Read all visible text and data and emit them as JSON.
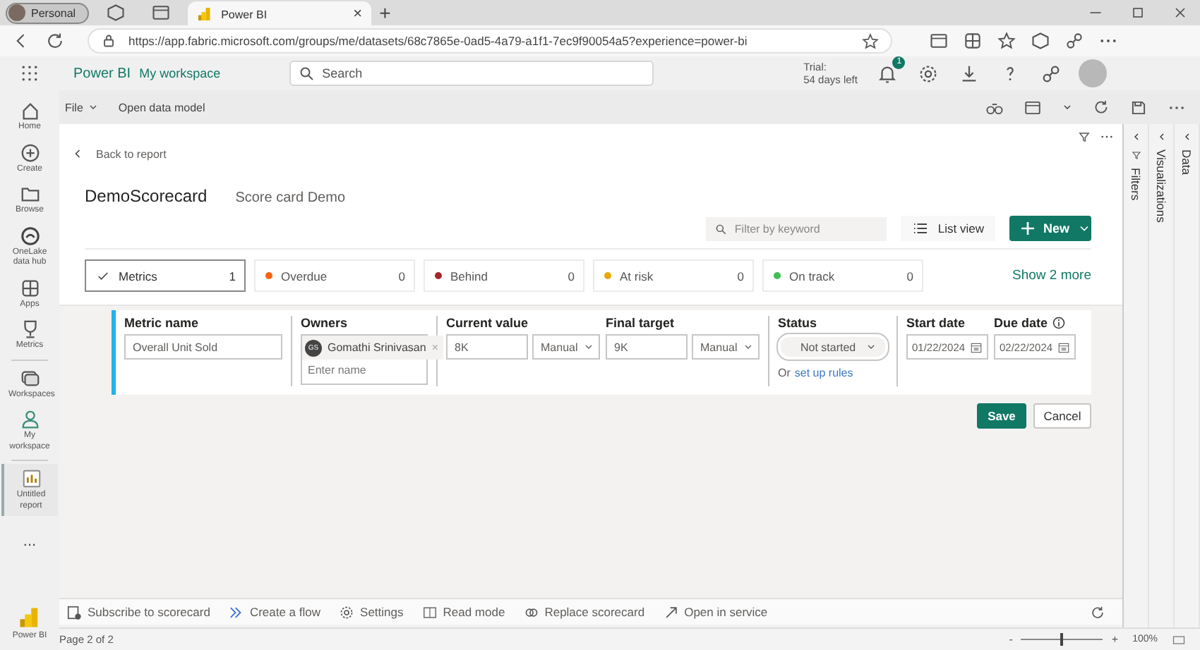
{
  "browser": {
    "profile": "Personal",
    "tabs": [
      {
        "title": "Power BI",
        "selected": true,
        "close": "×"
      }
    ],
    "new_tab": "+",
    "url": "https://app.fabric.microsoft.com/groups/me/datasets/68c7865e-0ad5-4a79-a1f1-7ec9f90054a5?experience=power-bi"
  },
  "header": {
    "app": "Power BI",
    "workspace": "My workspace",
    "search": {
      "placeholder": "Search"
    },
    "trial": "Trial:",
    "trial_days": "54 days left",
    "notifications": "1"
  },
  "nav": [
    {
      "label": "Home",
      "selected": false
    },
    {
      "label": "Create",
      "selected": false
    },
    {
      "label": "Browse",
      "selected": false
    },
    {
      "label": "OneLake data hub",
      "selected": false
    },
    {
      "label": "Apps",
      "selected": false
    },
    {
      "label": "Metrics",
      "selected": false
    },
    {
      "label": "Workspaces",
      "selected": false
    },
    {
      "label": "My workspace",
      "selected": false
    },
    {
      "label": "Untitled report",
      "selected": true
    }
  ],
  "nav_more": "...",
  "nav_brand": "Power BI",
  "toolbar": [
    {
      "label": "File",
      "dropdown": true
    },
    {
      "label": "Open data model",
      "dropdown": false
    }
  ],
  "scorecard": {
    "back": "Back to report",
    "name": "DemoScorecard",
    "description": "Score card Demo",
    "filter": {
      "placeholder": "Filter by keyword"
    },
    "list_view": "List view",
    "new": "New",
    "chips": [
      {
        "label": "Metrics",
        "count": "1",
        "selected": true
      },
      {
        "label": "Overdue",
        "count": "0",
        "selected": false,
        "color": "#f7630c"
      },
      {
        "label": "Behind",
        "count": "0",
        "selected": false,
        "color": "#a4262c"
      },
      {
        "label": "At risk",
        "count": "0",
        "selected": false,
        "color": "#e8a800"
      },
      {
        "label": "On track",
        "count": "0",
        "selected": false,
        "color": "#3fbf4f"
      }
    ],
    "show_more": "Show 2 more"
  },
  "editor": {
    "metric_name": {
      "label": "Metric name",
      "value": "Overall Unit Sold"
    },
    "owners": {
      "label": "Owners",
      "initials": "GS",
      "name": "Gomathi Srinivasan",
      "remove": "×",
      "placeholder": "Enter name"
    },
    "current_value": {
      "label": "Current value",
      "value": "8K",
      "mode": "Manual"
    },
    "final_target": {
      "label": "Final target",
      "value": "9K",
      "mode": "Manual"
    },
    "status": {
      "label": "Status",
      "value": "Not started",
      "rules_prefix": "Or",
      "rules_link": "set up rules"
    },
    "start_date": {
      "label": "Start date",
      "value": "01/22/2024"
    },
    "due_date": {
      "label": "Due date",
      "value": "02/22/2024"
    },
    "save": "Save",
    "cancel": "Cancel"
  },
  "actions": [
    "Subscribe to scorecard",
    "Create a flow",
    "Settings",
    "Read mode",
    "Replace scorecard",
    "Open in service"
  ],
  "panes": [
    "Filters",
    "Visualizations",
    "Data"
  ],
  "status_bar": {
    "page": "Page 2 of 2",
    "zoom_out": "-",
    "zoom": {
      "level": 0.5
    },
    "zoom_in": "+",
    "zoom_label": "100%"
  }
}
